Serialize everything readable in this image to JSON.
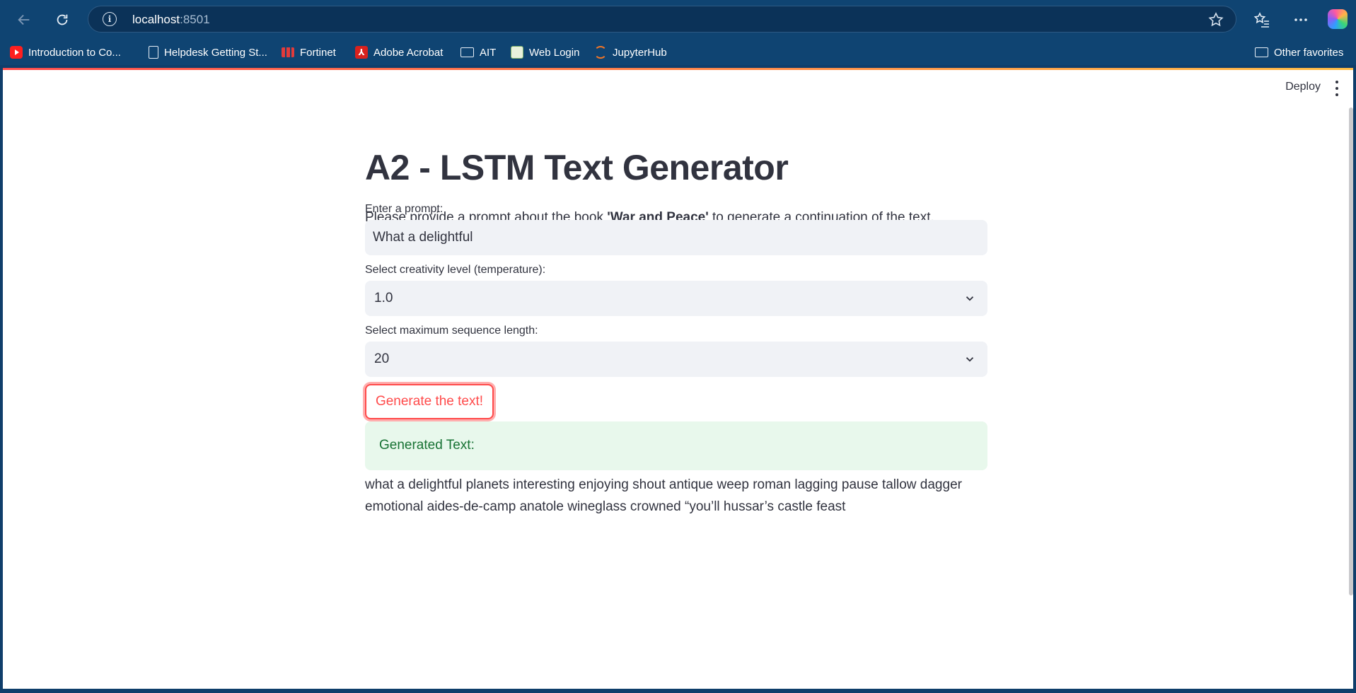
{
  "browser": {
    "url_host": "localhost",
    "url_port": ":8501",
    "info_icon_glyph": "i",
    "icons": {
      "back": "back-arrow-icon",
      "refresh": "refresh-icon",
      "favorite": "star-icon",
      "favorites": "favorites-icon",
      "menu": "more-horizontal-icon",
      "copilot": "copilot-icon"
    }
  },
  "bookmarks": {
    "items": [
      {
        "label": "Introduction to Co...",
        "icon": "youtube-icon"
      },
      {
        "label": "Helpdesk Getting St...",
        "icon": "document-icon"
      },
      {
        "label": "Fortinet",
        "icon": "fortinet-icon"
      },
      {
        "label": "Adobe Acrobat",
        "icon": "adobe-acrobat-icon"
      },
      {
        "label": "AIT",
        "icon": "folder-icon"
      },
      {
        "label": "Web Login",
        "icon": "web-login-icon"
      },
      {
        "label": "JupyterHub",
        "icon": "jupyter-icon"
      }
    ],
    "other": {
      "label": "Other favorites",
      "icon": "folder-icon"
    }
  },
  "app": {
    "deploy_label": "Deploy",
    "title": "A2 - LSTM Text Generator",
    "intro": {
      "before": "Please provide a prompt about the book ",
      "bold": "'War and Peace'",
      "after": " to generate a continuation of the text."
    },
    "prompt": {
      "label": "Enter a prompt:",
      "value": "What a delightful"
    },
    "temperature": {
      "label": "Select creativity level (temperature):",
      "value": "1.0"
    },
    "max_length": {
      "label": "Select maximum sequence length:",
      "value": "20"
    },
    "generate_label": "Generate the text!",
    "success_label": "Generated Text:",
    "generated_text": "what a delightful planets interesting enjoying shout antique weep roman lagging pause tallow dagger emotional aides-de-camp anatole wineglass crowned “you’ll hussar’s castle feast"
  },
  "colors": {
    "browser_bar": "#0f4472",
    "accent": "#ff4b4b",
    "success_bg": "#e8f8ec",
    "success_text": "#177233",
    "field_bg": "#f0f2f6",
    "text": "#31333f"
  }
}
